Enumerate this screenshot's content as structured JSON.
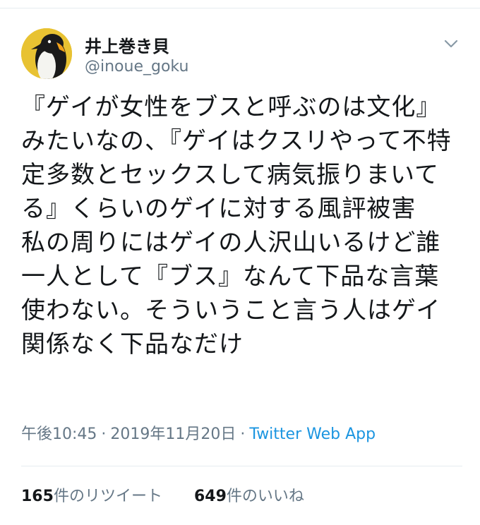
{
  "author": {
    "display_name": "井上巻き貝",
    "handle": "@inoue_goku",
    "avatar_icon": "penguin-avatar-icon",
    "avatar_bg": "#e8c232"
  },
  "menu_icon": "chevron-down-icon",
  "tweet": {
    "text": "『ゲイが女性をブスと呼ぶのは文化』みたいなの、『ゲイはクスリやって不特定多数とセックスして病気振りまいてる』くらいのゲイに対する風評被害　私の周りにはゲイの人沢山いるけど誰一人として『ブス』なんて下品な言葉使わない。そういうこと言う人はゲイ関係なく下品なだけ"
  },
  "meta": {
    "time": "午後10:45",
    "separator": "·",
    "date": "2019年11月20日",
    "source": "Twitter Web App"
  },
  "stats": {
    "retweets_count": "165",
    "retweets_label": "件のリツイート",
    "likes_count": "649",
    "likes_label": "件のいいね"
  },
  "colors": {
    "text": "#14171a",
    "secondary": "#657786",
    "link": "#1b95e0",
    "divider": "#e6ecf0"
  }
}
